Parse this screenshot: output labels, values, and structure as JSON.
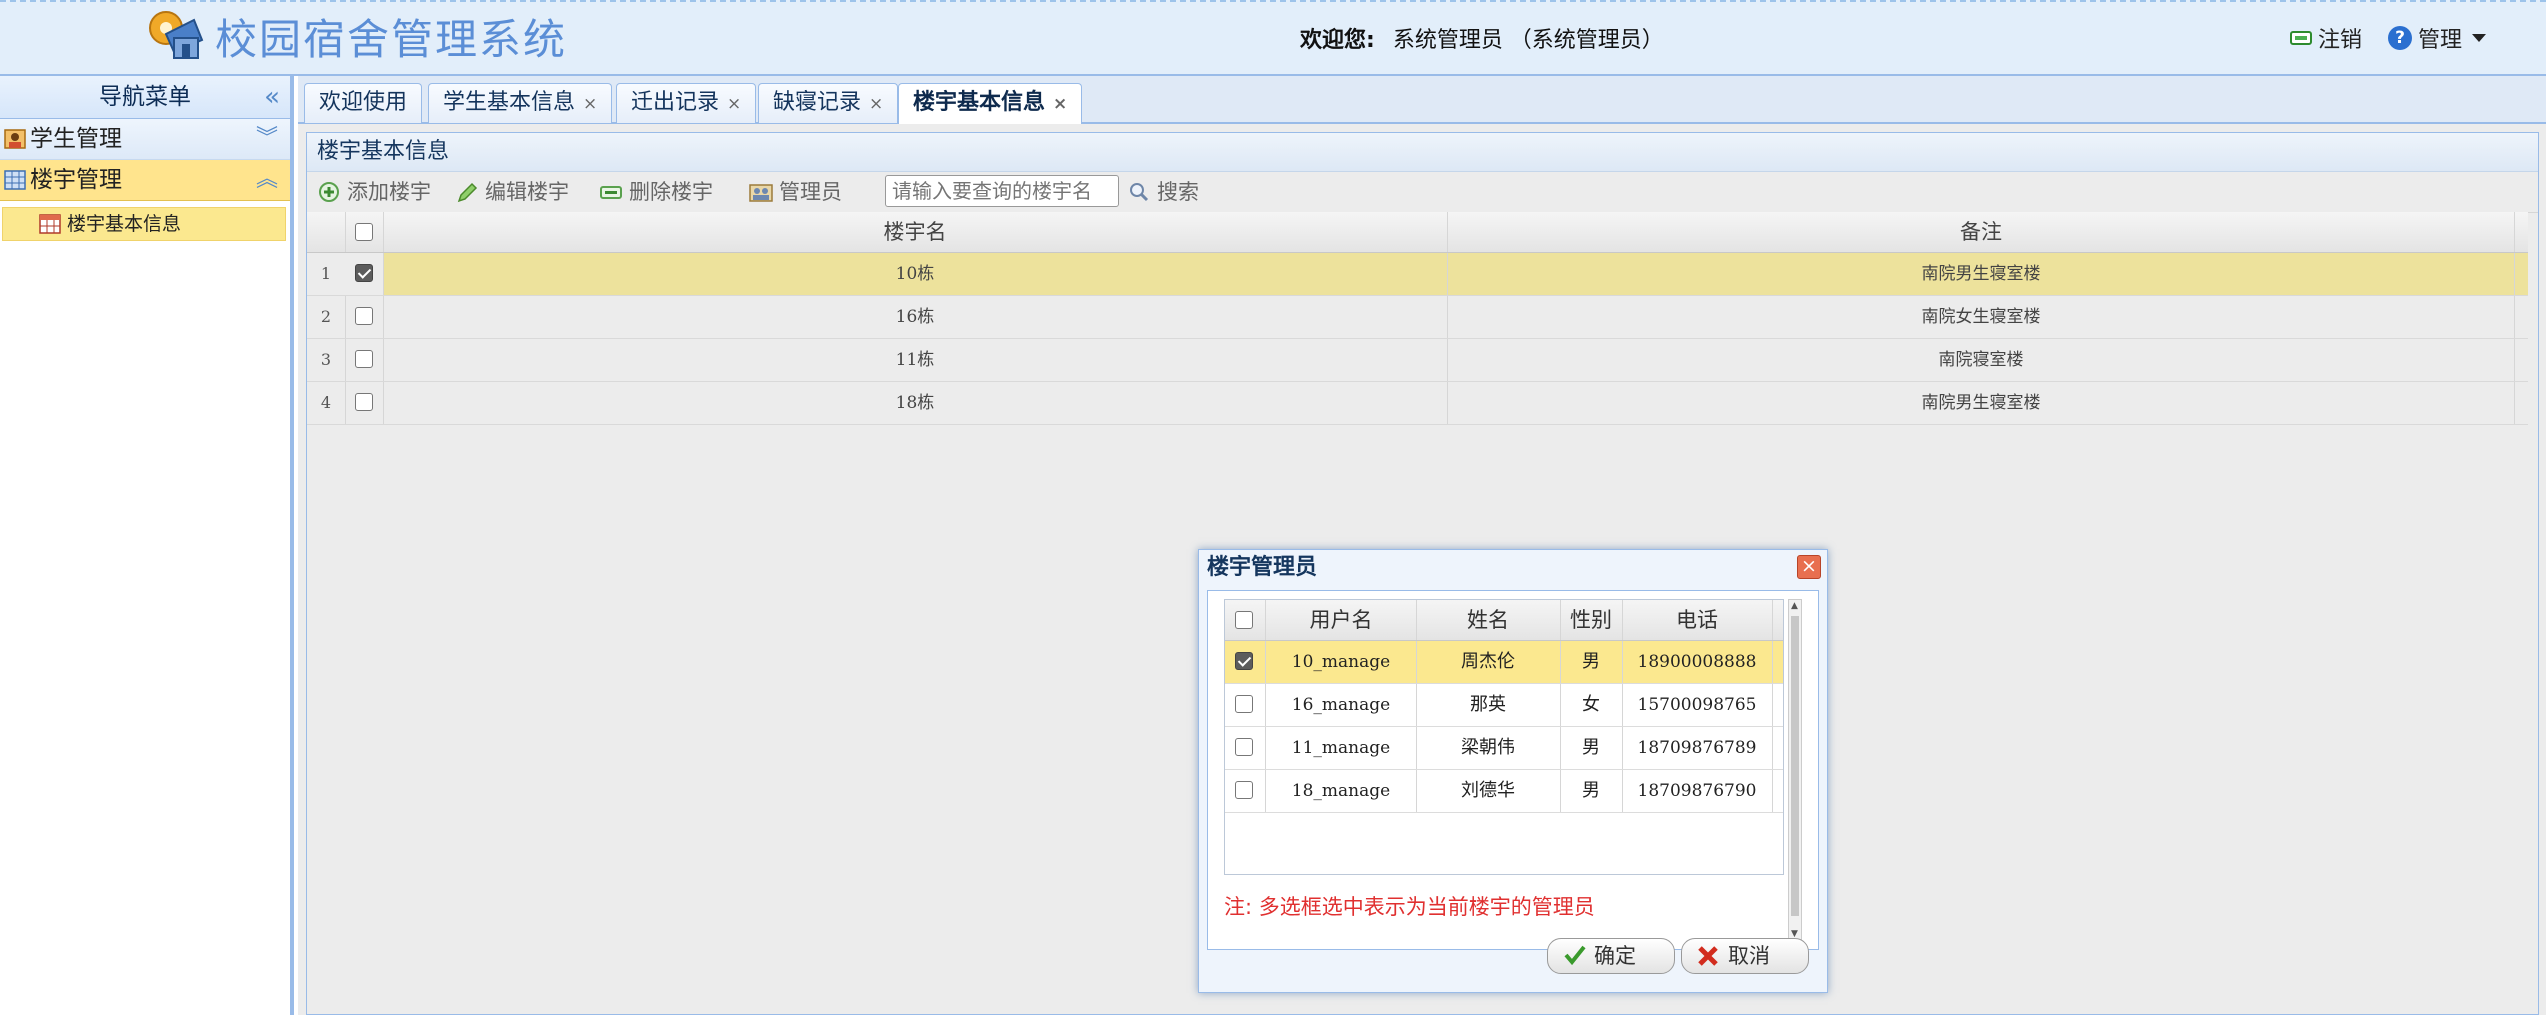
{
  "header": {
    "app_title": "校园宿舍管理系统",
    "welcome_label": "欢迎您:",
    "user_display": "系统管理员 （系统管理员）",
    "logout_label": "注销",
    "manage_label": "管理"
  },
  "nav": {
    "title": "导航菜单",
    "sections": [
      {
        "label": "学生管理",
        "expanded": false
      },
      {
        "label": "楼宇管理",
        "expanded": true,
        "items": [
          {
            "label": "楼宇基本信息"
          }
        ]
      }
    ]
  },
  "tabs": [
    {
      "label": "欢迎使用",
      "closable": false
    },
    {
      "label": "学生基本信息",
      "closable": true
    },
    {
      "label": "迁出记录",
      "closable": true
    },
    {
      "label": "缺寝记录",
      "closable": true
    },
    {
      "label": "楼宇基本信息",
      "closable": true,
      "active": true
    }
  ],
  "tab_close_glyph": "×",
  "panel": {
    "title": "楼宇基本信息",
    "toolbar": {
      "add_label": "添加楼宇",
      "edit_label": "编辑楼宇",
      "delete_label": "删除楼宇",
      "admin_label": "管理员",
      "search_placeholder": "请输入要查询的楼宇名",
      "search_label": "搜索"
    },
    "grid": {
      "columns": [
        "楼宇名",
        "备注"
      ],
      "rows": [
        {
          "num": "1",
          "name": "10栋",
          "note": "南院男生寝室楼",
          "checked": true
        },
        {
          "num": "2",
          "name": "16栋",
          "note": "南院女生寝室楼",
          "checked": false
        },
        {
          "num": "3",
          "name": "11栋",
          "note": "南院寝室楼",
          "checked": false
        },
        {
          "num": "4",
          "name": "18栋",
          "note": "南院男生寝室楼",
          "checked": false
        }
      ]
    }
  },
  "dialog": {
    "title": "楼宇管理员",
    "close_glyph": "×",
    "columns": [
      "用户名",
      "姓名",
      "性别",
      "电话"
    ],
    "rows": [
      {
        "username": "10_manage",
        "name": "周杰伦",
        "sex": "男",
        "phone": "18900008888",
        "checked": true
      },
      {
        "username": "16_manage",
        "name": "那英",
        "sex": "女",
        "phone": "15700098765",
        "checked": false
      },
      {
        "username": "11_manage",
        "name": "梁朝伟",
        "sex": "男",
        "phone": "18709876789",
        "checked": false
      },
      {
        "username": "18_manage",
        "name": "刘德华",
        "sex": "男",
        "phone": "18709876790",
        "checked": false
      }
    ],
    "note": "注:  多选框选中表示为当前楼宇的管理员",
    "ok_label": "确定",
    "cancel_label": "取消"
  },
  "colors": {
    "header_bg": "#e2eefa",
    "border_blue": "#99bbe8",
    "selected_row": "#ede29c",
    "nav_active": "#ffe48d",
    "note_red": "#e03030"
  }
}
